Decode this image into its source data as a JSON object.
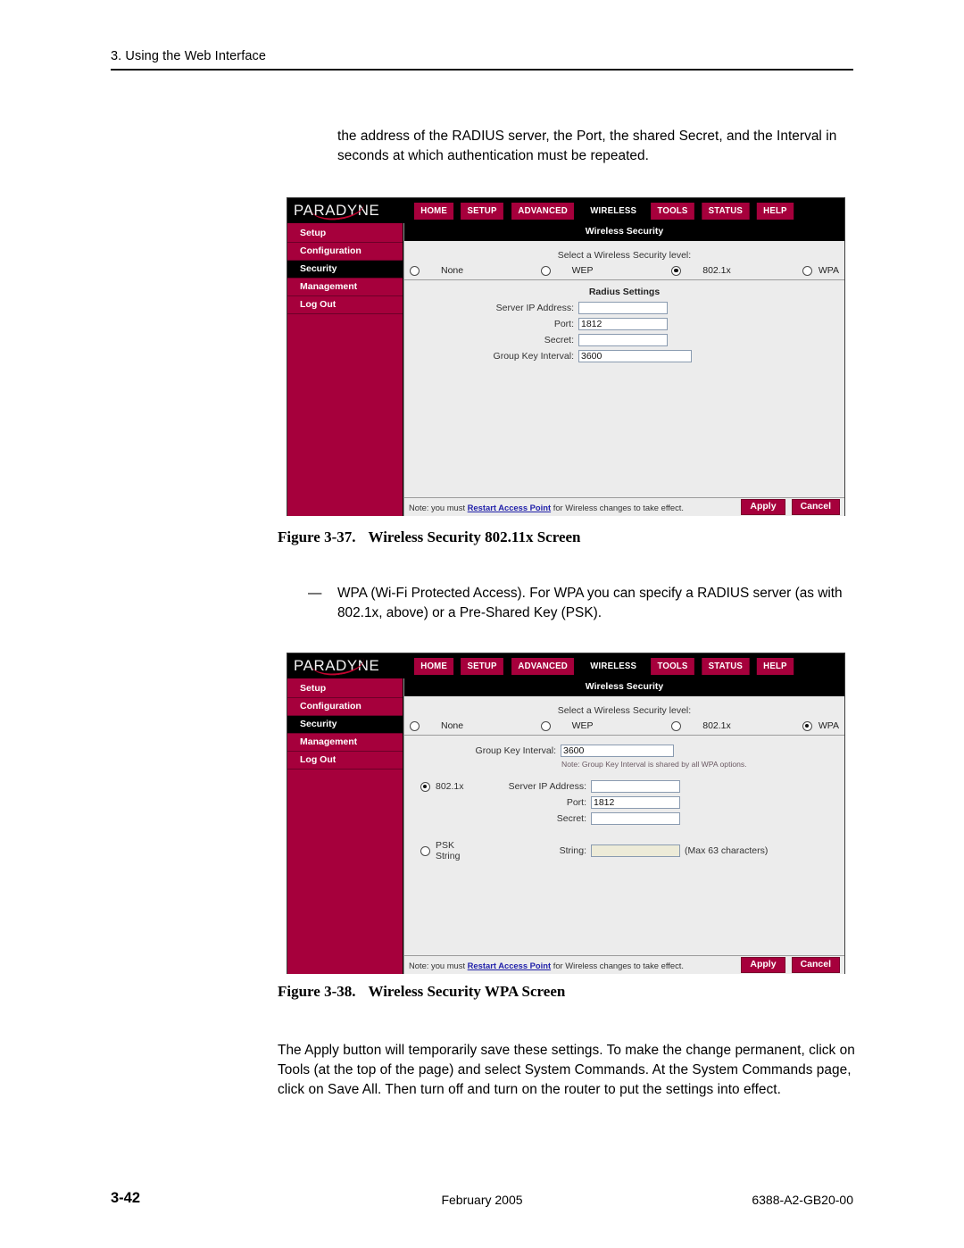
{
  "page": {
    "running_head": "3. Using the Web Interface",
    "intro_text": "the address of the RADIUS server, the Port, the shared Secret, and the Interval in seconds at which authentication must be repeated.",
    "bullet_dash": "—",
    "bullet_text": "WPA (Wi-Fi Protected Access). For WPA you can specify a RADIUS server (as with 802.1x, above) or a Pre-Shared Key (PSK).",
    "closing_text": "The Apply button will temporarily save these settings. To make the change permanent, click on Tools (at the top of the page) and select System Commands. At the System Commands page, click on Save All. Then turn off and turn on the router to put the settings into effect.",
    "footer": {
      "page_number": "3-42",
      "date": "February 2005",
      "doc_number": "6388-A2-GB20-00"
    }
  },
  "figures": {
    "fig1": {
      "number": "Figure 3-37.",
      "title": "Wireless Security 802.11x Screen"
    },
    "fig2": {
      "number": "Figure 3-38.",
      "title": "Wireless Security WPA Screen"
    }
  },
  "ui": {
    "brand": "PARADYNE",
    "nav": [
      {
        "label": "HOME",
        "active": false
      },
      {
        "label": "SETUP",
        "active": false
      },
      {
        "label": "ADVANCED",
        "active": false
      },
      {
        "label": "WIRELESS",
        "active": true
      },
      {
        "label": "TOOLS",
        "active": false
      },
      {
        "label": "STATUS",
        "active": false
      },
      {
        "label": "HELP",
        "active": false
      }
    ],
    "sidebar": [
      {
        "label": "Setup",
        "active": false
      },
      {
        "label": "Configuration",
        "active": false
      },
      {
        "label": "Security",
        "active": true
      },
      {
        "label": "Management",
        "active": false
      },
      {
        "label": "Log Out",
        "active": false
      }
    ],
    "panel_title": "Wireless Security",
    "security_level_label": "Select a Wireless Security level:",
    "security_levels": [
      "None",
      "WEP",
      "802.1x",
      "WPA"
    ],
    "footer_note_prefix": "Note: you must ",
    "footer_note_link": "Restart Access Point",
    "footer_note_suffix": " for Wireless changes to take effect.",
    "apply_label": "Apply",
    "cancel_label": "Cancel"
  },
  "screen1": {
    "selected_level": "802.1x",
    "radius_title": "Radius Settings",
    "fields": [
      {
        "label": "Server IP Address:",
        "value": ""
      },
      {
        "label": "Port:",
        "value": "1812"
      },
      {
        "label": "Secret:",
        "value": ""
      },
      {
        "label": "Group Key Interval:",
        "value": "3600"
      }
    ]
  },
  "screen2": {
    "selected_level": "WPA",
    "group_key_label": "Group Key Interval:",
    "group_key_value": "3600",
    "wpa_note": "Note: Group Key Interval is shared by all WPA options.",
    "option_8021x": {
      "label": "802.1x",
      "selected": true,
      "fields": [
        {
          "label": "Server IP Address:",
          "value": ""
        },
        {
          "label": "Port:",
          "value": "1812"
        },
        {
          "label": "Secret:",
          "value": ""
        }
      ]
    },
    "option_psk": {
      "label": "PSK String",
      "selected": false,
      "field_label": "String:",
      "field_value": "",
      "hint": "(Max 63 characters)"
    }
  }
}
